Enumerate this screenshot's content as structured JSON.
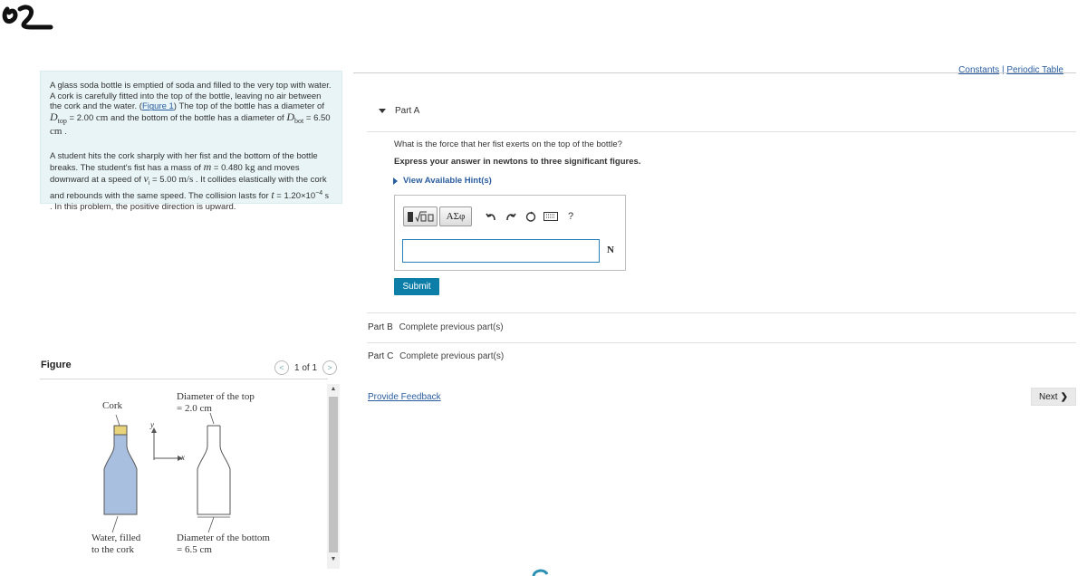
{
  "header": {
    "links": [
      "Constants",
      "Periodic Table"
    ],
    "separator": "|"
  },
  "problem": {
    "p1_text": "A glass soda bottle is emptied of soda and filled to the very top with water. A cork is carefully fitted into the top of the bottle, leaving no air between the cork and the water.",
    "figure_link": "Figure 1",
    "p1_text2": "The top of the bottle has a diameter of",
    "dtop_symbol": "D",
    "dtop_sub": "top",
    "dtop_value": "2.00",
    "cm_unit": "cm",
    "p1_text3": "and the bottom of the bottle has a diameter of",
    "dbot_symbol": "D",
    "dbot_sub": "bot",
    "dbot_value": "6.50",
    "p2_text1": "A student hits the cork sharply with her fist and the bottom of the bottle breaks. The student's fist has a mass of",
    "m_symbol": "m",
    "m_value": "0.480",
    "kg_unit": "kg",
    "p2_text2": "and moves downward at a speed of",
    "v_symbol": "v",
    "v_sub": "i",
    "v_value": "5.00",
    "v_unit": "m/s",
    "p2_text3": "It collides elastically with the cork and rebounds with the same speed. The collision lasts for",
    "t_symbol": "t",
    "t_value": "1.20×10",
    "t_exp": "−4",
    "t_unit": "s",
    "p2_text4": "In this problem, the positive direction is upward."
  },
  "figure": {
    "title": "Figure",
    "pager": "1 of 1",
    "labels": {
      "cork": "Cork",
      "diam_top_1": "Diameter of the top",
      "diam_top_2": "= 2.0 cm",
      "water_1": "Water, filled",
      "water_2": "to the cork",
      "diam_bot_1": "Diameter of  the bottom",
      "diam_bot_2": "= 6.5 cm",
      "axis_y": "y",
      "axis_x": "x"
    },
    "colors": {
      "water": "#a9bfe0",
      "cork": "#e8d27a"
    }
  },
  "part_a": {
    "title": "Part A",
    "question": "What is the force that her fist exerts on the top of the bottle?",
    "instruction": "Express your answer in newtons to three significant figures.",
    "hints": "View Available Hint(s)",
    "toolbar": {
      "greek": "ΑΣφ",
      "help": "?"
    },
    "answer_value": "",
    "unit": "N",
    "submit": "Submit"
  },
  "part_b": {
    "title": "Part B",
    "status": "Complete previous part(s)"
  },
  "part_c": {
    "title": "Part C",
    "status": "Complete previous part(s)"
  },
  "feedback": "Provide Feedback",
  "next": "Next",
  "colors": {
    "accent": "#0d7ea8",
    "link": "#2a5d9f",
    "problem_bg": "#e8f4f6"
  }
}
